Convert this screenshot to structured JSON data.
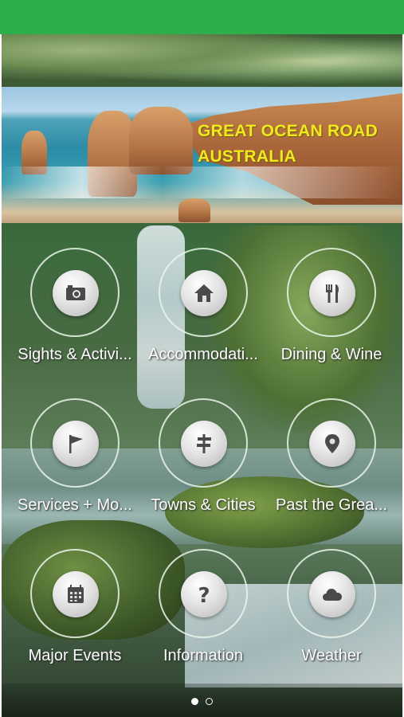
{
  "banner": {
    "line1": "GREAT OCEAN ROAD",
    "line2": "AUSTRALIA",
    "title_color": "#f2ea18"
  },
  "status_bar": {
    "color": "#2db04b"
  },
  "menu": [
    {
      "label": "Sights & Activi...",
      "icon": "camera-icon"
    },
    {
      "label": "Accommodati...",
      "icon": "home-icon"
    },
    {
      "label": "Dining & Wine",
      "icon": "fork-knife-icon"
    },
    {
      "label": "Services + Mo...",
      "icon": "flag-icon"
    },
    {
      "label": "Towns & Cities",
      "icon": "signpost-icon"
    },
    {
      "label": "Past the Grea...",
      "icon": "map-pin-icon"
    },
    {
      "label": "Major Events",
      "icon": "calendar-icon"
    },
    {
      "label": "Information",
      "icon": "question-icon"
    },
    {
      "label": "Weather",
      "icon": "cloud-icon"
    }
  ],
  "pager": {
    "pages": 2,
    "current": 1
  }
}
